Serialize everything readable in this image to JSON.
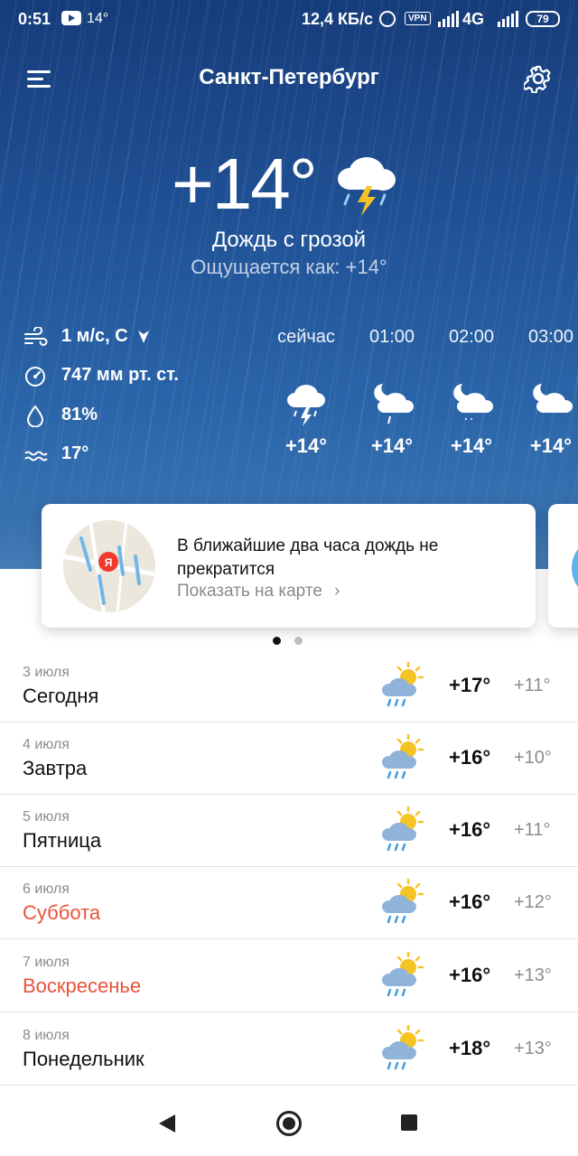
{
  "status_bar": {
    "time": "0:51",
    "notification_temp": "14°",
    "speed": "12,4 КБ/с",
    "vpn": "VPN",
    "network": "4G",
    "battery": "79"
  },
  "header": {
    "city": "Санкт-Петербург"
  },
  "current": {
    "temperature": "+14°",
    "condition": "Дождь с грозой",
    "feels_like": "Ощущается как: +14°",
    "icon": "thunderstorm-cloud-icon"
  },
  "details": {
    "wind": "1 м/с, С",
    "pressure": "747 мм рт. ст.",
    "humidity": "81%",
    "water_temp": "17°"
  },
  "hourly": [
    {
      "time": "сейчас",
      "temp": "+14°",
      "icon": "thunderstorm-icon"
    },
    {
      "time": "01:00",
      "temp": "+14°",
      "icon": "night-cloud-rain-icon"
    },
    {
      "time": "02:00",
      "temp": "+14°",
      "icon": "night-cloud-drizzle-icon"
    },
    {
      "time": "03:00",
      "temp": "+14°",
      "icon": "night-cloud-icon"
    }
  ],
  "card": {
    "title": "В ближайшие два часа дождь не прекратится",
    "link": "Показать на карте",
    "map_marker": "Я"
  },
  "carousel": {
    "active": 0,
    "total": 2
  },
  "colors": {
    "hero_top": "#163c7a",
    "hero_bottom": "#3a78b8",
    "weekend": "#e8533a",
    "muted": "#8c8c8c"
  },
  "forecast": [
    {
      "date": "3 июля",
      "day": "Сегодня",
      "hi": "+17°",
      "lo": "+11°",
      "weekend": false,
      "icon": "sun-cloud-rain-icon"
    },
    {
      "date": "4 июля",
      "day": "Завтра",
      "hi": "+16°",
      "lo": "+10°",
      "weekend": false,
      "icon": "sun-cloud-rain-icon"
    },
    {
      "date": "5 июля",
      "day": "Пятница",
      "hi": "+16°",
      "lo": "+11°",
      "weekend": false,
      "icon": "sun-cloud-rain-icon"
    },
    {
      "date": "6 июля",
      "day": "Суббота",
      "hi": "+16°",
      "lo": "+12°",
      "weekend": true,
      "icon": "sun-cloud-rain-icon"
    },
    {
      "date": "7 июля",
      "day": "Воскресенье",
      "hi": "+16°",
      "lo": "+13°",
      "weekend": true,
      "icon": "sun-cloud-rain-icon"
    },
    {
      "date": "8 июля",
      "day": "Понедельник",
      "hi": "+18°",
      "lo": "+13°",
      "weekend": false,
      "icon": "sun-cloud-rain-icon"
    }
  ]
}
